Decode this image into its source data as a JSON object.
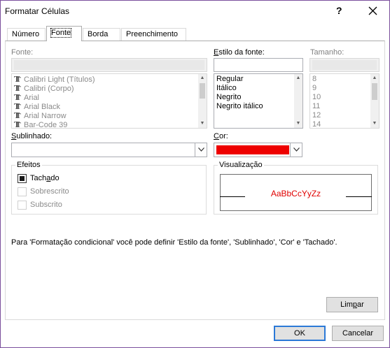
{
  "window": {
    "title": "Formatar Células",
    "help_icon": "question-mark",
    "close_icon": "x-close"
  },
  "tabs": [
    {
      "label": "Número",
      "active": false
    },
    {
      "label": "Fonte",
      "active": true
    },
    {
      "label": "Borda",
      "active": false
    },
    {
      "label": "Preenchimento",
      "active": false
    }
  ],
  "font": {
    "label": "Fonte:",
    "value": "",
    "items": [
      "Calibri Light (Títulos)",
      "Calibri (Corpo)",
      "Arial",
      "Arial Black",
      "Arial Narrow",
      "Bar-Code 39"
    ],
    "item_icon": "truetype-font-icon"
  },
  "style": {
    "label": "Estilo da fonte:",
    "value": "",
    "items": [
      "Regular",
      "Itálico",
      "Negrito",
      "Negrito itálico"
    ]
  },
  "size": {
    "label": "Tamanho:",
    "value": "",
    "items": [
      "8",
      "9",
      "10",
      "11",
      "12",
      "14"
    ]
  },
  "underline": {
    "label": "Sublinhado:",
    "value": ""
  },
  "color": {
    "label": "Cor:",
    "swatch": "#ee0000"
  },
  "effects": {
    "title": "Efeitos",
    "items": [
      {
        "label": "Tachado",
        "checked": true,
        "enabled": true
      },
      {
        "label": "Sobrescrito",
        "checked": false,
        "enabled": false
      },
      {
        "label": "Subscrito",
        "checked": false,
        "enabled": false
      }
    ]
  },
  "preview": {
    "title": "Visualização",
    "sample": "AaBbCcYyZz",
    "sample_color": "#e00000"
  },
  "info_text": "Para 'Formatação condicional' você pode definir 'Estilo da fonte', 'Sublinhado', 'Cor' e 'Tachado'.",
  "buttons": {
    "clear": "Limpar",
    "ok": "OK",
    "cancel": "Cancelar"
  },
  "accent": "#2b79d7"
}
